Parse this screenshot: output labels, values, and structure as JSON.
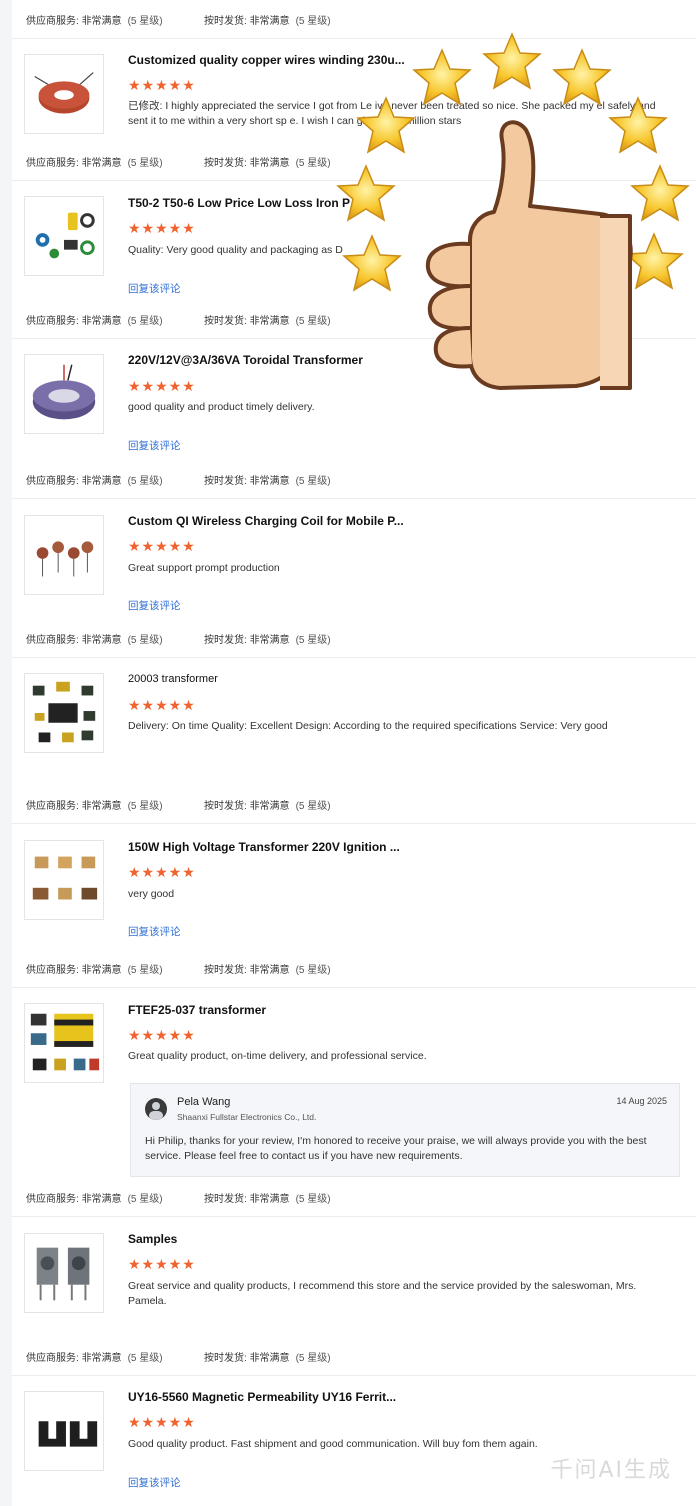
{
  "meta_labels": {
    "service_label": "供应商服务:",
    "service_value": "非常满意",
    "delivery_label": "按时发货:",
    "delivery_value": "非常满意",
    "level": "(5 星级)"
  },
  "stars_text": "★★★★★",
  "reply_link_label": "回复该评论",
  "reviews": [
    {
      "title": "Customized quality copper wires winding 230u...",
      "text": "已修改: I highly appreciated the service I got from Le  ive never been treated so nice. She packed my  el safely and sent it to me within a very short sp  e. I wish I can give her a million stars",
      "reply_link": false,
      "thumb_icon": "toroid-copper-icon"
    },
    {
      "title": "T50-2 T50-6 Low Price Low Loss Iron P  T...",
      "text": "Quality:  Very good quality and packaging as  D",
      "reply_link": true,
      "thumb_icon": "iron-powder-cores-icon"
    },
    {
      "title": "220V/12V@3A/36VA Toroidal Transformer",
      "text": "good  quality and product timely delivery.",
      "reply_link": true,
      "thumb_icon": "toroidal-transformer-icon"
    },
    {
      "title": "Custom QI Wireless Charging Coil for Mobile P...",
      "text": "Great support prompt production",
      "reply_link": true,
      "thumb_icon": "wireless-coil-icon"
    },
    {
      "title": "20003 transformer",
      "text": "Delivery:  On time Quality:  Excellent Design:  According to the required specifications Service:  Very good",
      "reply_link": false,
      "thumb_icon": "smd-transformers-icon"
    },
    {
      "title": "150W High Voltage Transformer 220V Ignition ...",
      "text": "very good",
      "reply_link": true,
      "thumb_icon": "hv-transformers-icon"
    },
    {
      "title": "FTEF25-037 transformer",
      "text": "Great quality product, on-time delivery, and professional service.",
      "reply_link": false,
      "thumb_icon": "ef25-transformer-icon"
    },
    {
      "title": "Samples",
      "text": "Great service and quality products, I recommend this store and the service provided by the saleswoman, Mrs. Pamela.",
      "reply_link": false,
      "thumb_icon": "sample-transformers-icon"
    },
    {
      "title": "UY16-5560 Magnetic Permeability UY16 Ferrit...",
      "text": "Good quality product. Fast shipment and good communication. Will buy fom them again.",
      "reply_link": true,
      "thumb_icon": "ferrite-core-icon"
    }
  ],
  "seller_reply": {
    "name": "Pela Wang",
    "company": "Shaanxi Fullstar Electronics Co., Ltd.",
    "date": "14 Aug 2025",
    "text": "Hi Philip, thanks for your review, I'm honored to receive your praise, we will always provide you with the best service.  Please feel free to contact us if you have new requirements."
  },
  "overlay": {
    "icon": "thumbs-up-with-stars-icon"
  },
  "watermark": "千问AI生成",
  "colors": {
    "star": "#f0622e",
    "link": "#2f6fd6",
    "gold": "#f7c62b",
    "skin": "#f3c9a0"
  }
}
